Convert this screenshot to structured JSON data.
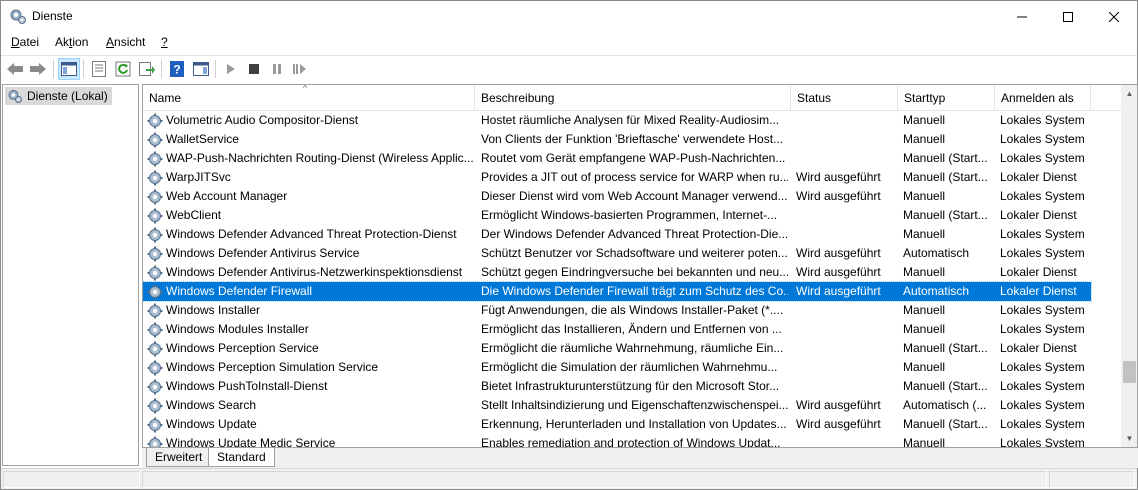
{
  "window": {
    "title": "Dienste"
  },
  "menu": [
    {
      "label_pre": "",
      "accel": "D",
      "label_post": "atei"
    },
    {
      "label_pre": "Ak",
      "accel": "t",
      "label_post": "ion"
    },
    {
      "label_pre": "",
      "accel": "A",
      "label_post": "nsicht"
    },
    {
      "label_pre": "",
      "accel": "?",
      "label_post": ""
    }
  ],
  "tree": {
    "root_label": "Dienste (Lokal)"
  },
  "columns": {
    "name": "Name",
    "description": "Beschreibung",
    "status": "Status",
    "startup": "Starttyp",
    "logon": "Anmelden als"
  },
  "services": [
    {
      "name": "Volumetric Audio Compositor-Dienst",
      "description": "Hostet räumliche Analysen für Mixed Reality-Audiosim...",
      "status": "",
      "startup": "Manuell",
      "logon": "Lokales System"
    },
    {
      "name": "WalletService",
      "description": "Von Clients der Funktion 'Brieftasche' verwendete Host...",
      "status": "",
      "startup": "Manuell",
      "logon": "Lokales System"
    },
    {
      "name": "WAP-Push-Nachrichten Routing-Dienst (Wireless Applic...",
      "description": "Routet vom Gerät empfangene WAP-Push-Nachrichten...",
      "status": "",
      "startup": "Manuell (Start...",
      "logon": "Lokales System"
    },
    {
      "name": "WarpJITSvc",
      "description": "Provides a JIT out of process service for WARP when ru...",
      "status": "Wird ausgeführt",
      "startup": "Manuell (Start...",
      "logon": "Lokaler Dienst"
    },
    {
      "name": "Web Account Manager",
      "description": "Dieser Dienst wird vom Web Account Manager verwend...",
      "status": "Wird ausgeführt",
      "startup": "Manuell",
      "logon": "Lokales System"
    },
    {
      "name": "WebClient",
      "description": "Ermöglicht Windows-basierten Programmen, Internet-...",
      "status": "",
      "startup": "Manuell (Start...",
      "logon": "Lokaler Dienst"
    },
    {
      "name": "Windows Defender Advanced Threat Protection-Dienst",
      "description": "Der Windows Defender Advanced Threat Protection-Die...",
      "status": "",
      "startup": "Manuell",
      "logon": "Lokales System"
    },
    {
      "name": "Windows Defender Antivirus Service",
      "description": "Schützt Benutzer vor Schadsoftware und weiterer poten...",
      "status": "Wird ausgeführt",
      "startup": "Automatisch",
      "logon": "Lokales System"
    },
    {
      "name": "Windows Defender Antivirus-Netzwerkinspektionsdienst",
      "description": "Schützt gegen Eindringversuche bei bekannten und neu...",
      "status": "Wird ausgeführt",
      "startup": "Manuell",
      "logon": "Lokaler Dienst"
    },
    {
      "name": "Windows Defender Firewall",
      "description": "Die Windows Defender Firewall trägt zum Schutz des Co...",
      "status": "Wird ausgeführt",
      "startup": "Automatisch",
      "logon": "Lokaler Dienst",
      "selected": true
    },
    {
      "name": "Windows Installer",
      "description": "Fügt Anwendungen, die als Windows Installer-Paket (*....",
      "status": "",
      "startup": "Manuell",
      "logon": "Lokales System"
    },
    {
      "name": "Windows Modules Installer",
      "description": "Ermöglicht das Installieren, Ändern und Entfernen von ...",
      "status": "",
      "startup": "Manuell",
      "logon": "Lokales System"
    },
    {
      "name": "Windows Perception Service",
      "description": "Ermöglicht die räumliche Wahrnehmung, räumliche Ein...",
      "status": "",
      "startup": "Manuell (Start...",
      "logon": "Lokaler Dienst"
    },
    {
      "name": "Windows Perception Simulation Service",
      "description": "Ermöglicht die Simulation der räumlichen Wahrnehmu...",
      "status": "",
      "startup": "Manuell",
      "logon": "Lokales System"
    },
    {
      "name": "Windows PushToInstall-Dienst",
      "description": "Bietet Infrastrukturunterstützung für den Microsoft Stor...",
      "status": "",
      "startup": "Manuell (Start...",
      "logon": "Lokales System"
    },
    {
      "name": "Windows Search",
      "description": "Stellt Inhaltsindizierung und Eigenschaftenzwischenspei...",
      "status": "Wird ausgeführt",
      "startup": "Automatisch (...",
      "logon": "Lokales System"
    },
    {
      "name": "Windows Update",
      "description": "Erkennung, Herunterladen und Installation von Updates...",
      "status": "Wird ausgeführt",
      "startup": "Manuell (Start...",
      "logon": "Lokales System"
    },
    {
      "name": "Windows Update Medic Service",
      "description": "Enables remediation and protection of Windows Updat...",
      "status": "",
      "startup": "Manuell",
      "logon": "Lokales System"
    }
  ],
  "tabs": {
    "extended": "Erweitert",
    "standard": "Standard"
  },
  "colors": {
    "selection": "#0078d7",
    "help_icon": "#1f5fbf"
  }
}
